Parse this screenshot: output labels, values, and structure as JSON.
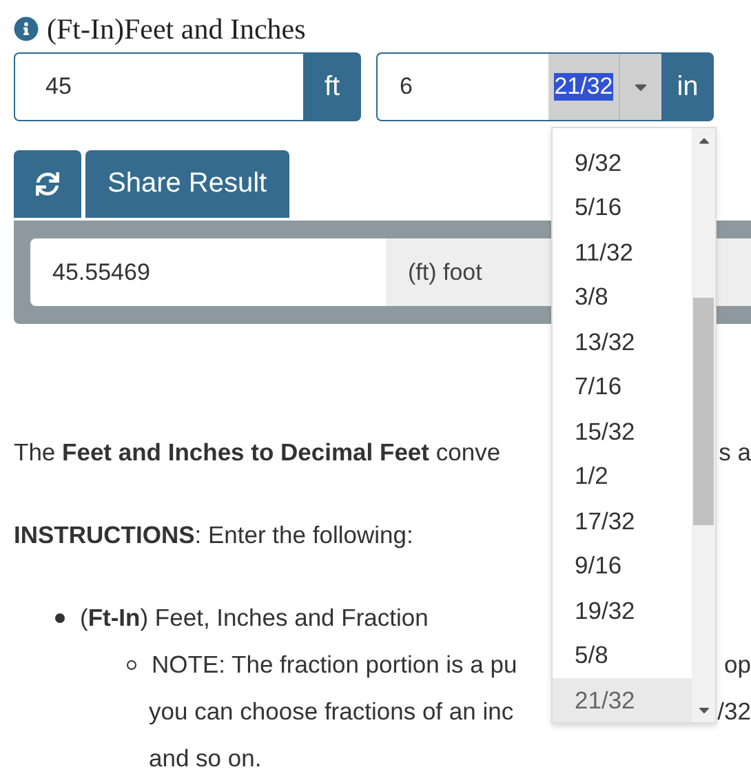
{
  "header": {
    "title": "(Ft-In)Feet and Inches"
  },
  "feet": {
    "value": "45",
    "unit": "ft"
  },
  "inches": {
    "value": "6",
    "fraction": "21/32",
    "unit": "in"
  },
  "actions": {
    "share_label": "Share Result"
  },
  "result": {
    "value": "45.55469",
    "unit": "(ft) foot"
  },
  "fraction_options": [
    {
      "label": "9/32",
      "selected": false
    },
    {
      "label": "5/16",
      "selected": false
    },
    {
      "label": "11/32",
      "selected": false
    },
    {
      "label": "3/8",
      "selected": false
    },
    {
      "label": "13/32",
      "selected": false
    },
    {
      "label": "7/16",
      "selected": false
    },
    {
      "label": "15/32",
      "selected": false
    },
    {
      "label": "1/2",
      "selected": false
    },
    {
      "label": "17/32",
      "selected": false
    },
    {
      "label": "9/16",
      "selected": false
    },
    {
      "label": "19/32",
      "selected": false
    },
    {
      "label": "5/8",
      "selected": false
    },
    {
      "label": "21/32",
      "selected": true
    }
  ],
  "article": {
    "intro": {
      "left": "The **Feet and Inches to Decimal Feet** conve",
      "right": "s a"
    },
    "instructions": "**INSTRUCTIONS**: Enter the following:",
    "bullets": [
      {
        "text": "(**Ft-In**) Feet, Inches and Fraction",
        "children": [
          {
            "left": "NOTE: The fraction portion is a pu",
            "right": "op"
          },
          {
            "left": "you can choose fractions of an inc",
            "right": "/32"
          },
          {
            "left": "and so on."
          }
        ]
      }
    ]
  }
}
